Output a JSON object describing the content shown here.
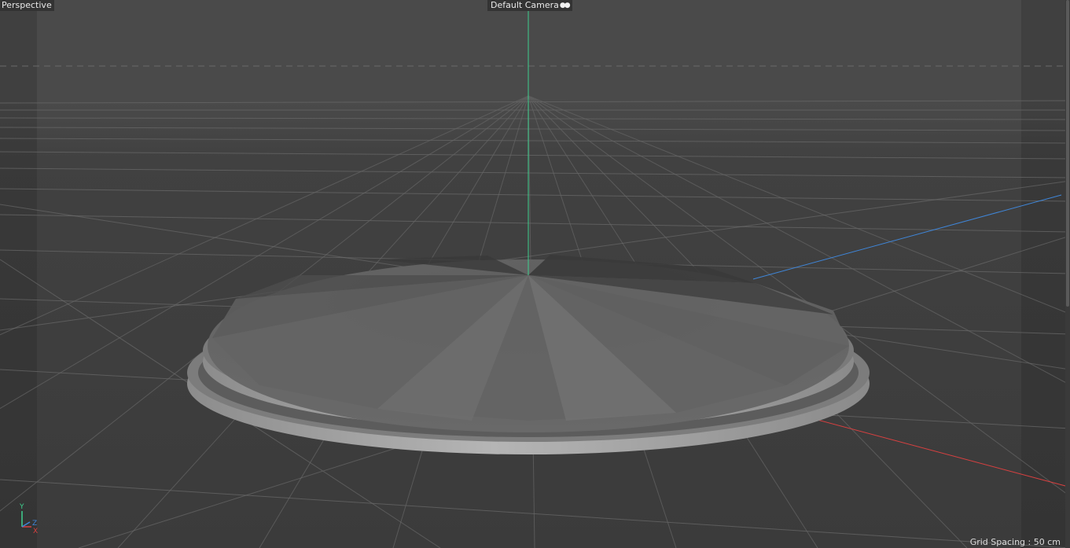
{
  "viewport": {
    "view_name": "Perspective",
    "camera_name": "Default Camera",
    "camera_icon": "camera-orbit-icon",
    "grid_spacing": "Grid Spacing : 50 cm"
  },
  "axes": {
    "x_label": "X",
    "y_label": "Y",
    "z_label": "Z",
    "x_color": "#d94040",
    "y_color": "#3ecf8e",
    "z_color": "#3f86d9"
  },
  "colors": {
    "background_top": "#4a4a4a",
    "background_bottom": "#3b3b3b",
    "grid_line": "#6b6b6b",
    "object_fill": "#6e6e6e",
    "object_rim": "#a8a8a8"
  }
}
